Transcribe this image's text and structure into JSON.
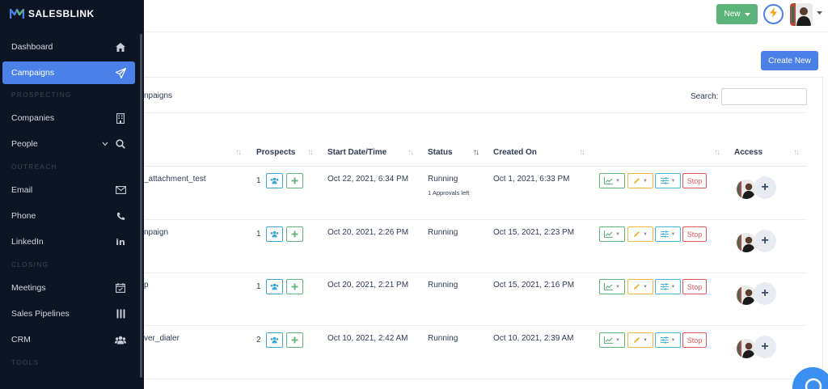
{
  "brand": {
    "name": "SALESBLINK"
  },
  "sidebar": {
    "items": [
      {
        "label": "Dashboard",
        "icon": "home-icon"
      },
      {
        "label": "Campaigns",
        "icon": "paper-plane-icon",
        "active": true
      },
      {
        "label": "Companies",
        "icon": "building-icon"
      },
      {
        "label": "People",
        "icon": "search-icon"
      },
      {
        "label": "Email",
        "icon": "envelope-icon"
      },
      {
        "label": "Phone",
        "icon": "phone-icon"
      },
      {
        "label": "LinkedIn",
        "icon": "linkedin-icon"
      },
      {
        "label": "Meetings",
        "icon": "calendar-icon"
      },
      {
        "label": "Sales Pipelines",
        "icon": "columns-icon"
      },
      {
        "label": "CRM",
        "icon": "users-icon"
      }
    ],
    "sections": {
      "prospecting": "PROSPECTING",
      "outreach": "OUTREACH",
      "closing": "CLOSING",
      "tools": "TOOLS"
    }
  },
  "header": {
    "new_label": "New",
    "create_new_label": "Create New"
  },
  "card": {
    "title_fragment": "npaigns",
    "search_label": "Search:"
  },
  "table": {
    "headers": {
      "prospects": "Prospects",
      "start": "Start Date/Time",
      "status": "Status",
      "created": "Created On",
      "access": "Access"
    },
    "rows": [
      {
        "name": "_attachment_test",
        "prospects": "1",
        "start": "Oct 22, 2021, 6:34 PM",
        "status": "Running",
        "note": "1 Approvals left",
        "created": "Oct 1, 2021, 6:33 PM",
        "stop": "Stop"
      },
      {
        "name": "npaign",
        "prospects": "1",
        "start": "Oct 20, 2021, 2:26 PM",
        "status": "Running",
        "note": "",
        "created": "Oct 15, 2021, 2:23 PM",
        "stop": "Stop"
      },
      {
        "name": "p",
        "prospects": "1",
        "start": "Oct 20, 2021, 2:21 PM",
        "status": "Running",
        "note": "",
        "created": "Oct 15, 2021, 2:16 PM",
        "stop": "Stop"
      },
      {
        "name": "ver_dialer",
        "prospects": "2",
        "start": "Oct 10, 2021, 2:42 AM",
        "status": "Running",
        "note": "",
        "created": "Oct 10, 2021, 2:39 AM",
        "stop": "Stop"
      }
    ]
  },
  "colors": {
    "accent": "#4a80e8",
    "sidebar_bg": "#0d1424",
    "success": "#5db47b",
    "danger": "#e0575b"
  }
}
